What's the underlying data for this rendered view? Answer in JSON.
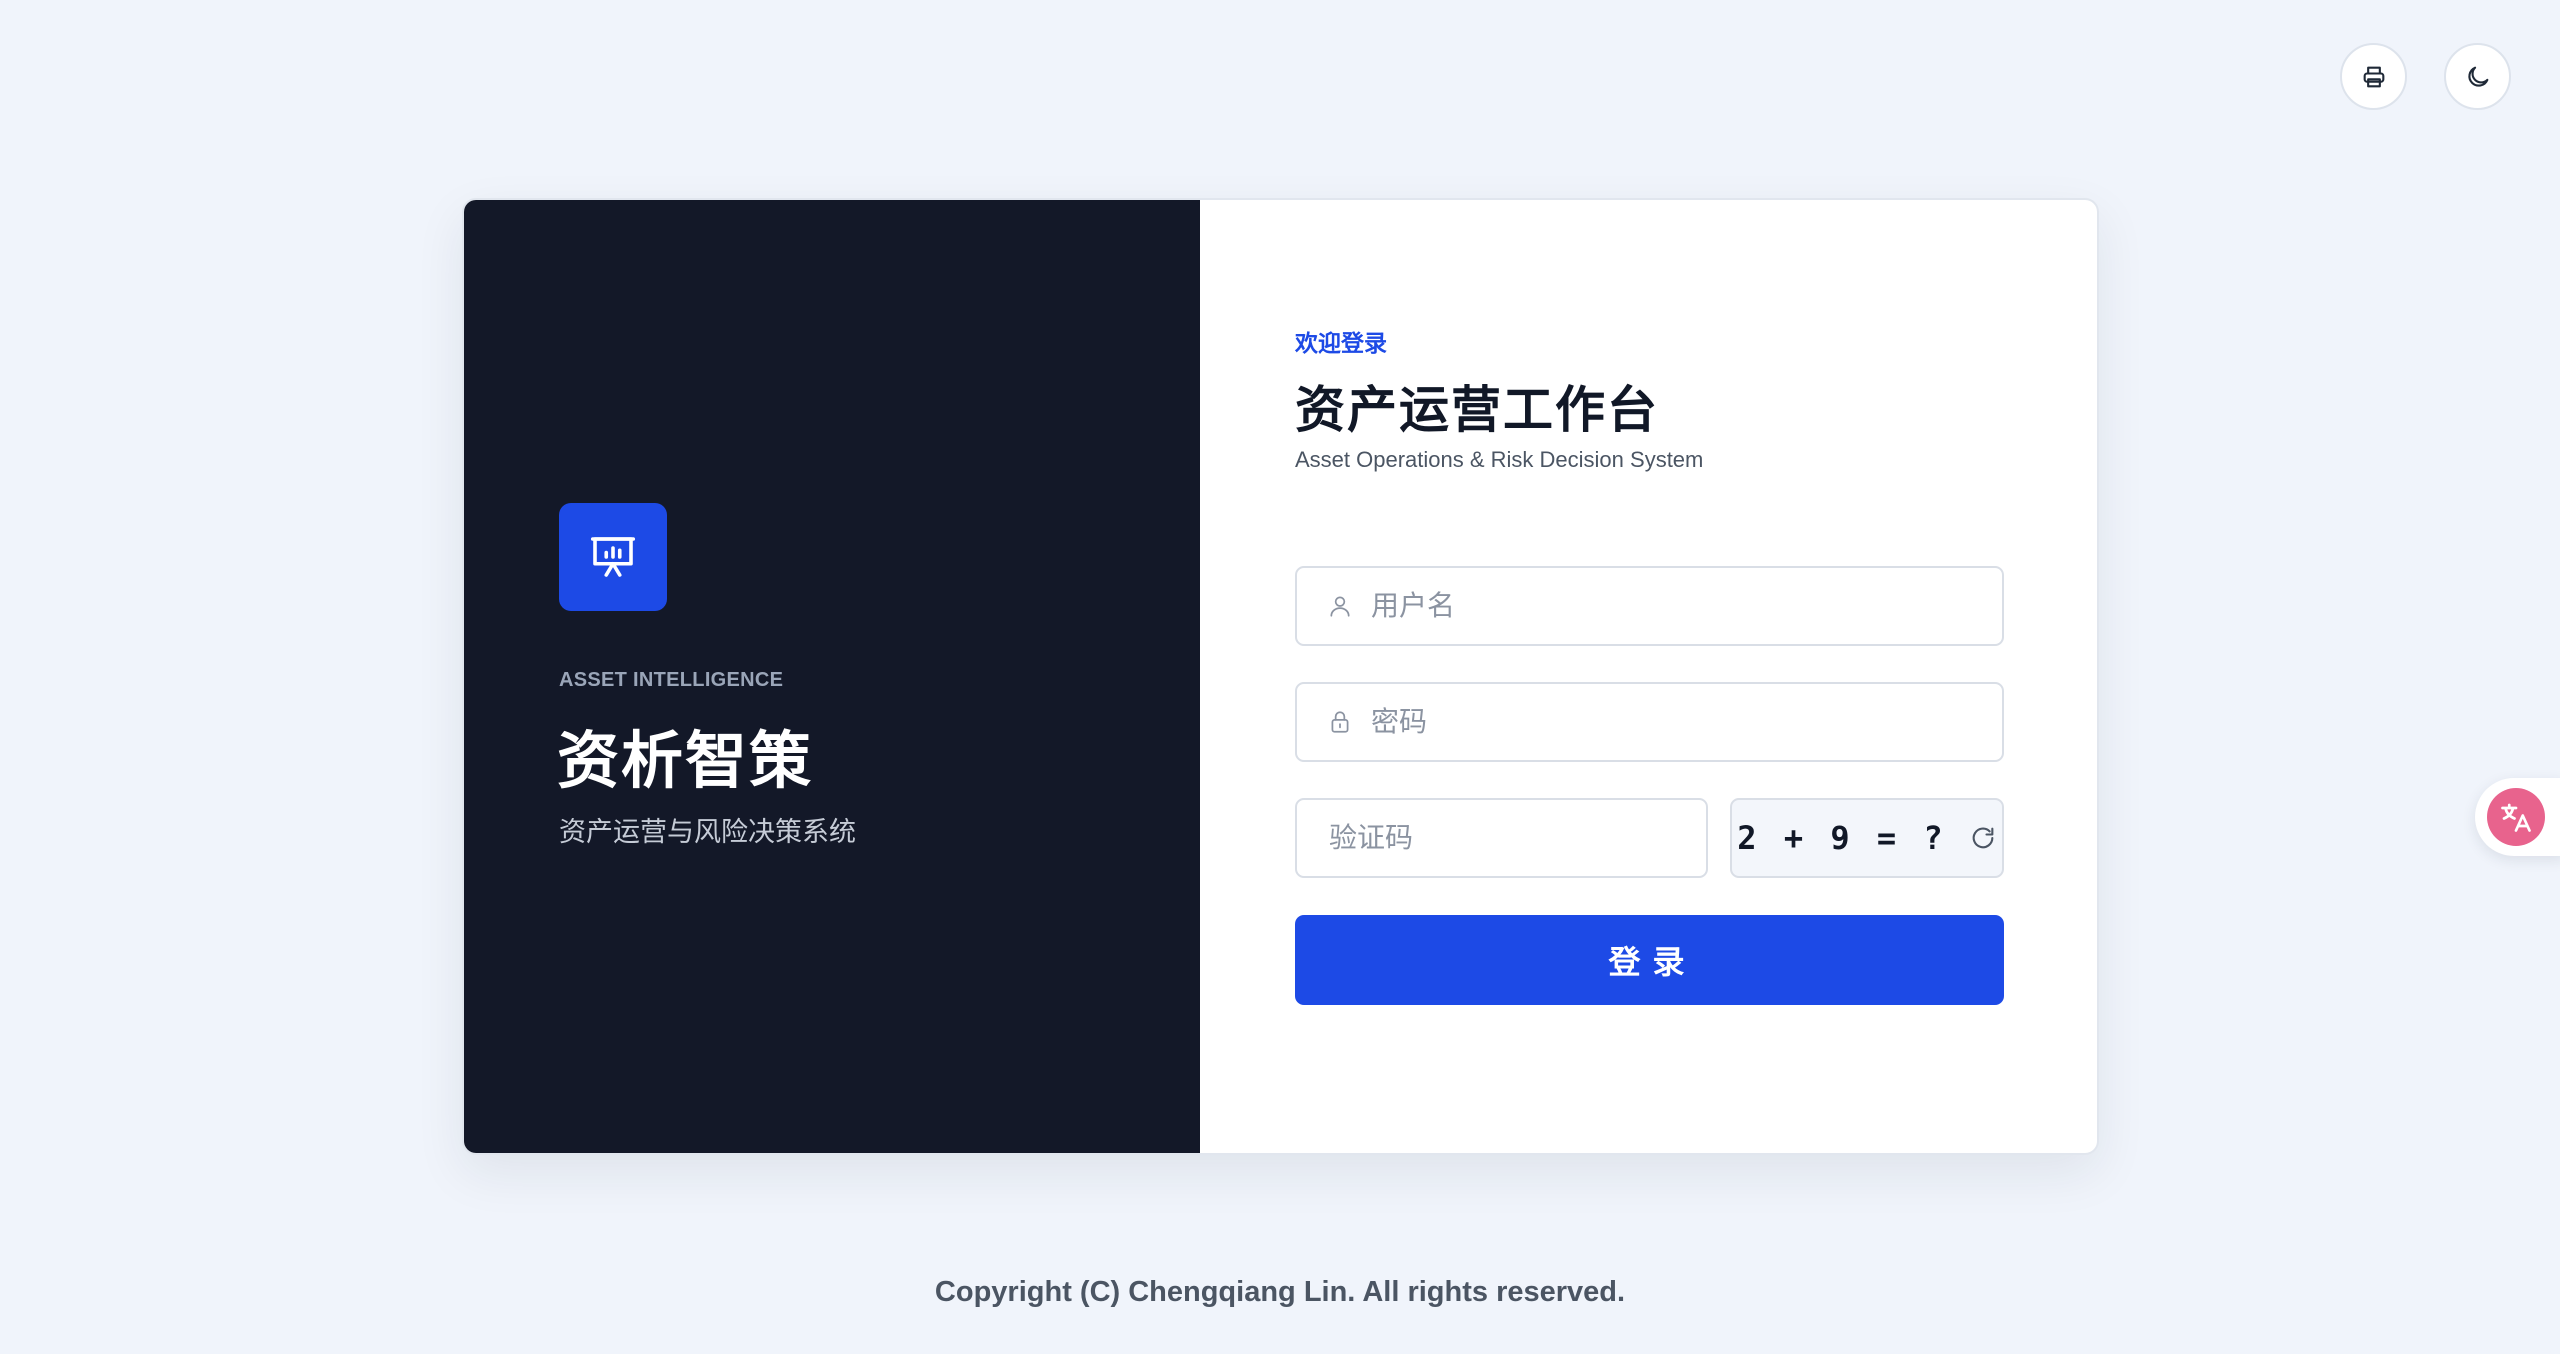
{
  "header": {
    "actions": [
      {
        "icon": "printer-icon",
        "label": ""
      },
      {
        "icon": "moon-icon",
        "label": ""
      }
    ]
  },
  "brand": {
    "eyebrow": "ASSET INTELLIGENCE",
    "title": "资析智策",
    "subtitle": "资产运营与风险决策系统",
    "logo_icon": "presentation-chart-icon",
    "accent_color": "#1d4ae6",
    "panel_color": "#131828"
  },
  "login": {
    "welcome": "欢迎登录",
    "title": "资产运营工作台",
    "subtitle": "Asset Operations & Risk Decision System",
    "username": {
      "value": "",
      "placeholder": "用户名",
      "icon": "user-icon"
    },
    "password": {
      "value": "",
      "placeholder": "密码",
      "icon": "lock-icon"
    },
    "captcha": {
      "value": "",
      "placeholder": "验证码",
      "challenge": "2 + 9 = ?",
      "refresh_icon": "refresh-icon"
    },
    "submit_label": "登录"
  },
  "footer": {
    "copyright": "Copyright (C) Chengqiang Lin. All rights reserved."
  },
  "floating": {
    "translate_icon": "translate-icon",
    "translate_color": "#e8638d"
  }
}
